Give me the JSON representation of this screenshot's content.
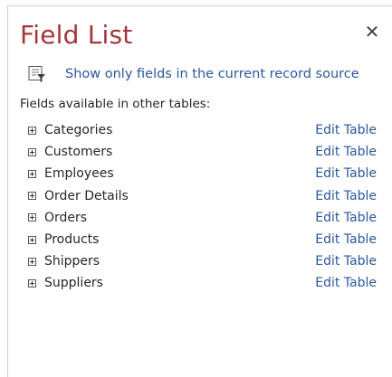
{
  "pane": {
    "title": "Field List",
    "close_symbol": "✕",
    "show_only_label": "Show only fields in the current record source",
    "section_label": "Fields available in other tables:",
    "edit_label": "Edit Table",
    "tables": [
      {
        "name": "Categories"
      },
      {
        "name": "Customers"
      },
      {
        "name": "Employees"
      },
      {
        "name": "Order Details"
      },
      {
        "name": "Orders"
      },
      {
        "name": "Products"
      },
      {
        "name": "Shippers"
      },
      {
        "name": "Suppliers"
      }
    ]
  },
  "icons": {
    "close": "close-icon",
    "show_only": "filter-document-icon",
    "expander": "expand-plus-icon"
  },
  "colors": {
    "title": "#a4373a",
    "link": "#2b579a",
    "text": "#262626"
  }
}
